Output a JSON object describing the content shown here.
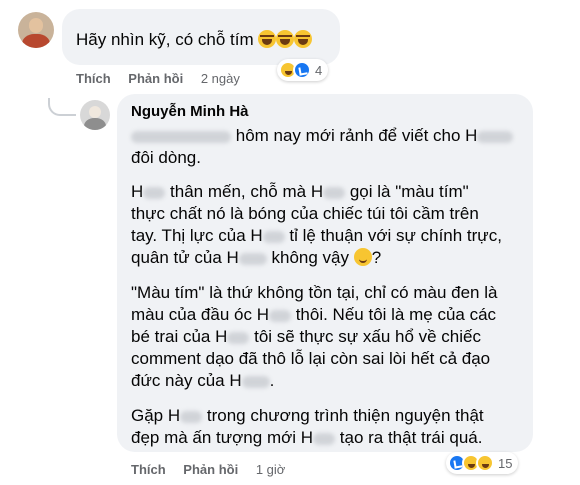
{
  "comment1": {
    "text": "Hãy nhìn kỹ, có chỗ tím",
    "actions": {
      "like": "Thích",
      "reply": "Phản hồi",
      "time": "2 ngày"
    },
    "reaction_count": "4"
  },
  "comment2": {
    "author": "Nguyễn Minh Hà",
    "lines": {
      "l1": "hôm nay mới rảnh để viết cho H",
      "l2": "đôi dòng.",
      "l3a": "H",
      "l3b": "thân mến, chỗ mà H",
      "l3c": "gọi là \"màu tím\"",
      "l4": "thực chất nó là bóng của chiếc túi tôi cầm trên",
      "l5a": "tay. Thị lực của H",
      "l5b": "tỉ lệ thuận với sự chính trực,",
      "l6a": "quân tử của H",
      "l6b": "không vậy",
      "l6c": "?",
      "l7": "\"Màu tím\" là thứ không tồn tại, chỉ có màu đen là",
      "l8a": "màu của đầu óc H",
      "l8b": "thôi. Nếu tôi là mẹ của các",
      "l9a": "bé trai của H",
      "l9b": "tôi sẽ thực sự xấu hổ về chiếc",
      "l10": "comment dạo đã thô lỗ lại còn sai lòi hết cả đạo",
      "l11a": "đức này của H",
      "l12a": "Gặp H",
      "l12b": "trong chương trình thiện nguyện thật",
      "l13a": "đẹp mà ấn tượng mới H",
      "l13b": "tạo ra thật trái quá."
    },
    "actions": {
      "like": "Thích",
      "reply": "Phản hồi",
      "time": "1 giờ"
    },
    "reaction_count": "15"
  },
  "colors": {
    "bubble": "#f0f2f5",
    "meta": "#65676b",
    "like": "#1877f2",
    "haha": "#f7c531"
  }
}
